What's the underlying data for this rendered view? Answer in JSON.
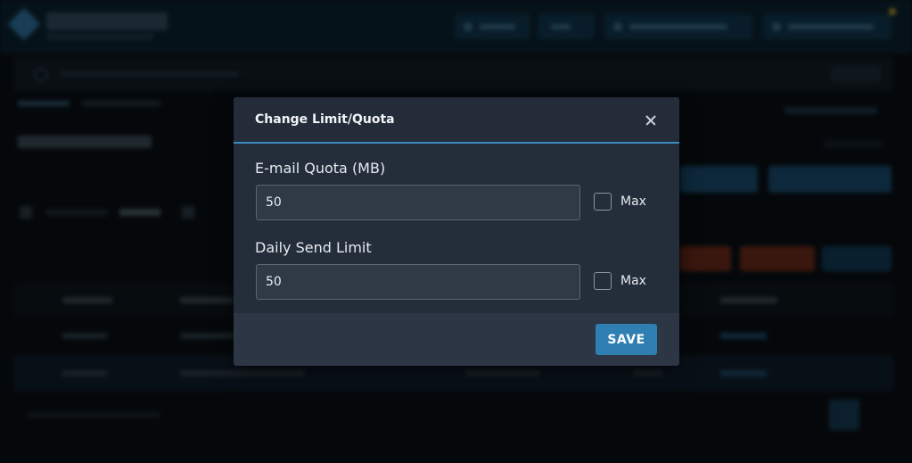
{
  "modal": {
    "title": "Change Limit/Quota",
    "close_icon": "close-icon",
    "fields": [
      {
        "label": "E-mail Quota (MB)",
        "value": "50",
        "max_label": "Max",
        "max_checked": false
      },
      {
        "label": "Daily Send Limit",
        "value": "50",
        "max_label": "Max",
        "max_checked": false
      }
    ],
    "save_label": "SAVE"
  },
  "colors": {
    "accent": "#3a8cc4",
    "save_button": "#2f7fb3",
    "modal_bg": "#242d3a",
    "input_bg": "#303946"
  }
}
